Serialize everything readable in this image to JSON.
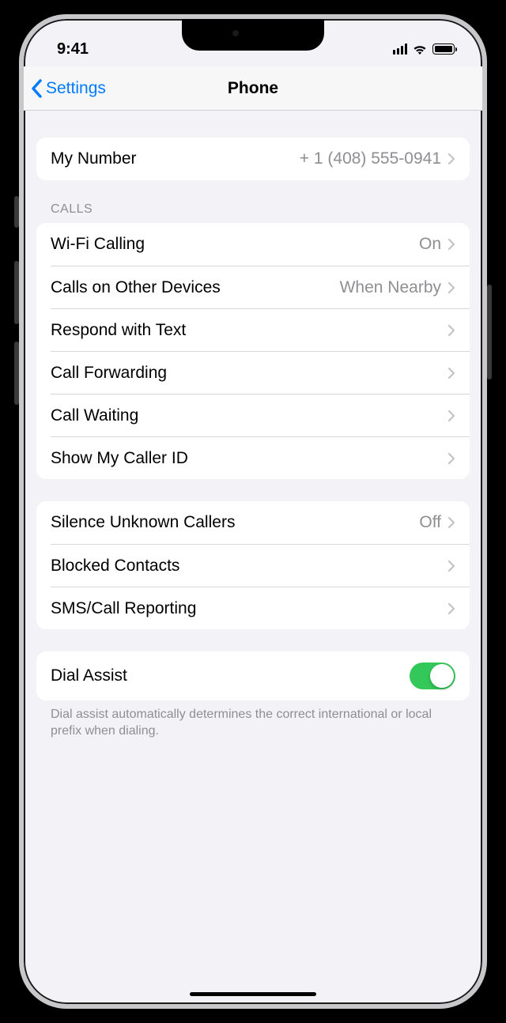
{
  "status": {
    "time": "9:41"
  },
  "nav": {
    "back_label": "Settings",
    "title": "Phone"
  },
  "sections": {
    "my_number": {
      "label": "My Number",
      "value": "+ 1 (408) 555-0941"
    },
    "calls_header": "CALLS",
    "calls": [
      {
        "label": "Wi-Fi Calling",
        "value": "On"
      },
      {
        "label": "Calls on Other Devices",
        "value": "When Nearby"
      },
      {
        "label": "Respond with Text",
        "value": ""
      },
      {
        "label": "Call Forwarding",
        "value": ""
      },
      {
        "label": "Call Waiting",
        "value": ""
      },
      {
        "label": "Show My Caller ID",
        "value": ""
      }
    ],
    "blocking": [
      {
        "label": "Silence Unknown Callers",
        "value": "Off"
      },
      {
        "label": "Blocked Contacts",
        "value": ""
      },
      {
        "label": "SMS/Call Reporting",
        "value": ""
      }
    ],
    "dial_assist": {
      "label": "Dial Assist",
      "on": true,
      "footer": "Dial assist automatically determines the correct international or local prefix when dialing."
    }
  }
}
